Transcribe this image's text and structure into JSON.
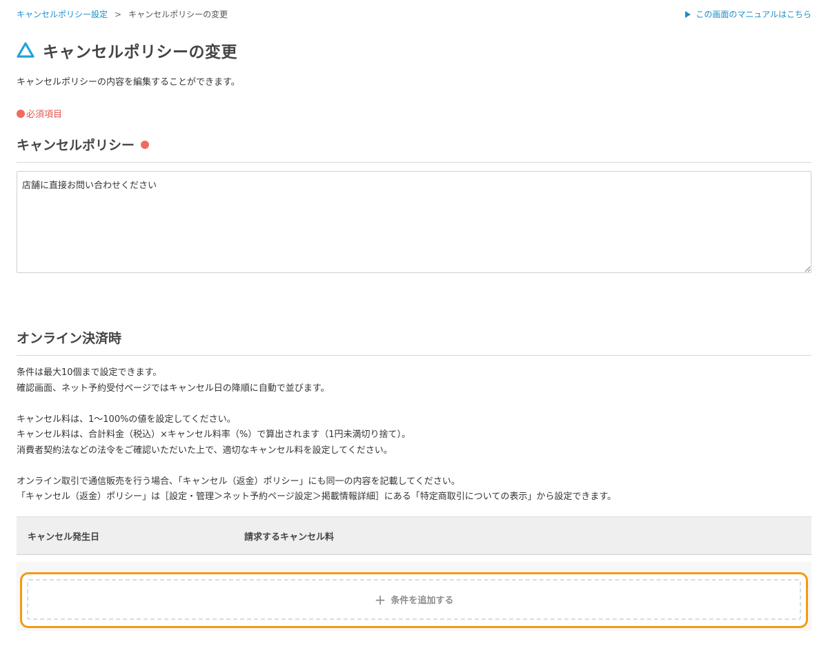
{
  "breadcrumb": {
    "parent": "キャンセルポリシー設定",
    "separator": ">",
    "current": "キャンセルポリシーの変更"
  },
  "manual_link": "この画面のマニュアルはこちら",
  "page_title": "キャンセルポリシーの変更",
  "intro": "キャンセルポリシーの内容を編集することができます。",
  "required_note": "必須項目",
  "policy_section": {
    "heading": "キャンセルポリシー",
    "textarea_value": "店舗に直接お問い合わせください"
  },
  "online_section": {
    "heading": "オンライン決済時",
    "desc_lines": [
      "条件は最大10個まで設定できます。",
      "確認画面、ネット予約受付ページではキャンセル日の降順に自動で並びます。",
      "",
      "キャンセル料は、1〜100%の値を設定してください。",
      "キャンセル料は、合計料金（税込）×キャンセル料率（%）で算出されます（1円未満切り捨て）。",
      "消費者契約法などの法令をご確認いただいた上で、適切なキャンセル料を設定してください。",
      "",
      "オンライン取引で通信販売を行う場合、「キャンセル（返金）ポリシー」にも同一の内容を記載してください。",
      "「キャンセル（返金）ポリシー」は［設定・管理＞ネット予約ページ設定＞掲載情報詳細］にある「特定商取引についての表示」から設定できます。"
    ],
    "table_headers": [
      "キャンセル発生日",
      "請求するキャンセル料"
    ],
    "add_button_label": "条件を追加する"
  },
  "colors": {
    "link": "#1a8fc9",
    "required": "#f06b5e",
    "highlight": "#f39a0e",
    "logo": "#1fa3d9"
  },
  "icons": {
    "logo": "triangle-logo-icon",
    "manual": "play-triangle-icon",
    "add": "plus-icon"
  }
}
